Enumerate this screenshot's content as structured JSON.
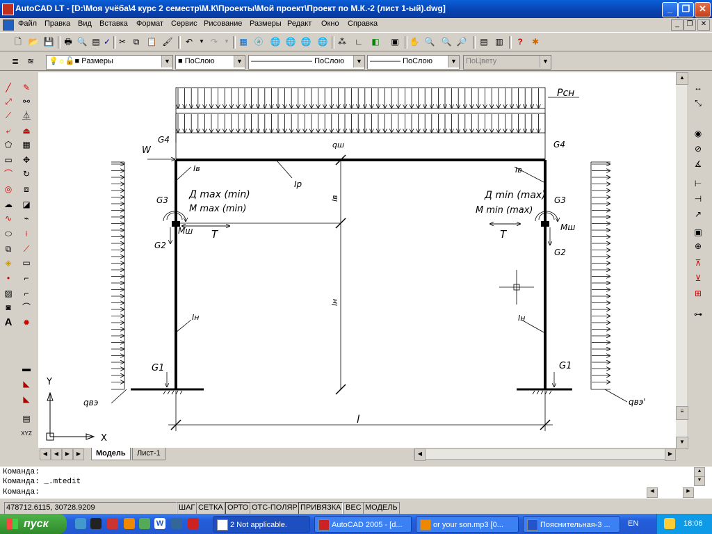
{
  "window": {
    "title": "AutoCAD LT - [D:\\Моя учёба\\4 курс 2 семестр\\М.К\\Проекты\\Мой проект\\Проект по М.К.-2 (лист 1-ый).dwg]"
  },
  "menu": [
    "Файл",
    "Правка",
    "Вид",
    "Вставка",
    "Формат",
    "Сервис",
    "Рисование",
    "Размеры",
    "Редакт",
    "Окно",
    "Справка"
  ],
  "props": {
    "layer": "Размеры",
    "color": "ПоСлою",
    "linetype": "ПоСлою",
    "lineweight": "ПоСлою",
    "plotstyle": "ПоЦвету"
  },
  "drawing": {
    "labels": {
      "p_sn": "Pсн",
      "q_sh": "qш",
      "g4_left": "G4",
      "g4_right": "G4",
      "w": "W",
      "i_v_left": "Iв",
      "i_v_right": "Iв",
      "i_r": "Iр",
      "l_v": "lв",
      "d_left": "Д max (min)",
      "m_left": "M max (min)",
      "d_right": "Д min (max)",
      "m_right": "M min (max)",
      "g3_left": "G3",
      "g3_right": "G3",
      "mw_left": "Mш",
      "mw_right": "Mш",
      "t_left": "T",
      "t_right": "T",
      "g2_left": "G2",
      "g2_right": "G2",
      "l_n": "lн",
      "i_n_left": "Iн",
      "i_n_right": "Iн",
      "g1_left": "G1",
      "g1_right": "G1",
      "q_left": "qвэ",
      "q_right": "qвэ'",
      "span": "l"
    },
    "ucs": {
      "x": "X",
      "y": "Y"
    }
  },
  "tabs": {
    "model": "Модель",
    "sheet": "Лист-1"
  },
  "command_lines": [
    "Команда:",
    "Команда: _.mtedit",
    "Команда:"
  ],
  "status": {
    "coords": "478712.6115, 30728.9209",
    "buttons": [
      "ШАГ",
      "СЕТКА",
      "ОРТО",
      "ОТС-ПОЛЯР",
      "ПРИВЯЗКА",
      "ВЕС",
      "МОДЕЛЬ"
    ]
  },
  "taskbar": {
    "start": "пуск",
    "tasks": [
      "2 Not applicable.",
      "AutoCAD 2005 - [d...",
      "or your son.mp3 [0...",
      "Пояснительная-3 ..."
    ],
    "lang": "EN",
    "time": "18:06"
  },
  "colors": {
    "titlebar": "#0842b0",
    "taskbar": "#245edb",
    "start": "#2f8a2a",
    "face": "#d4d0c8"
  }
}
